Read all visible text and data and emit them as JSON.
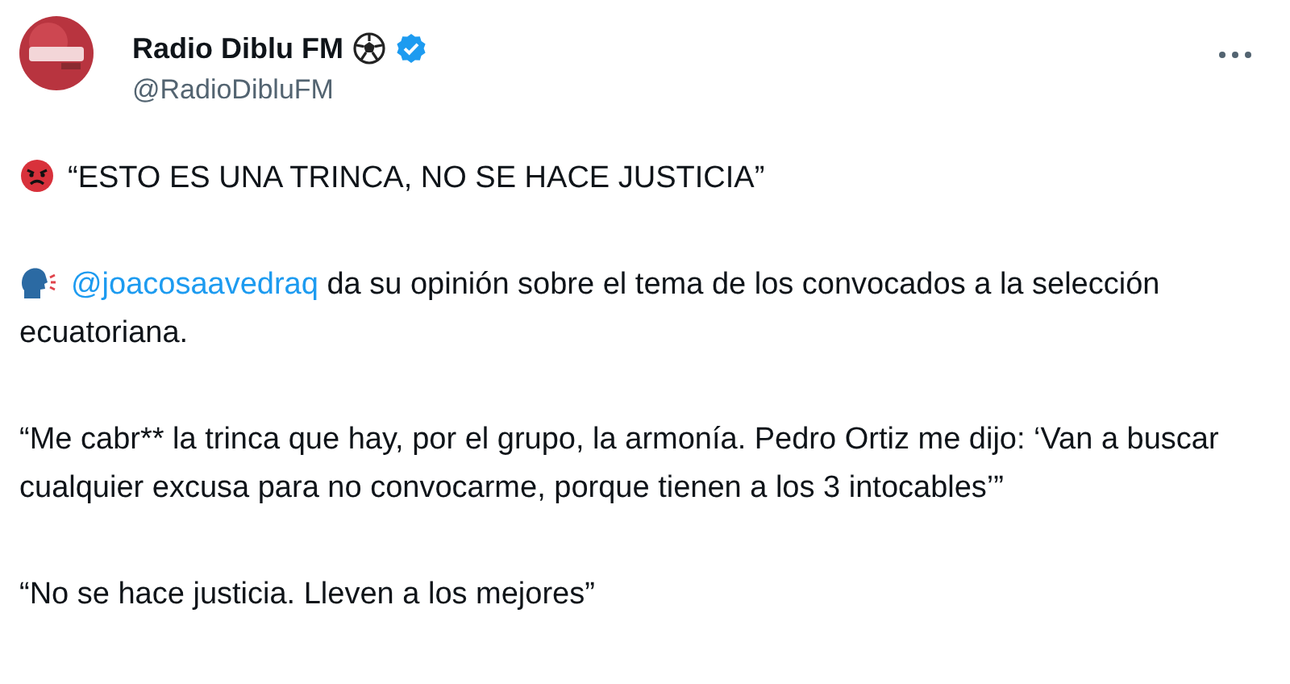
{
  "author": {
    "name": "Radio Diblu FM",
    "handle": "@RadioDibluFM",
    "verified": true
  },
  "paragraphs": [
    {
      "kind": "angry",
      "text": "“ESTO ES UNA TRINCA, NO SE HACE JUSTICIA”"
    },
    {
      "kind": "speaking",
      "mention": "@joacosaavedraq",
      "text": " da su opinión sobre el tema de los convocados a la selección ecuatoriana."
    },
    {
      "kind": "plain",
      "text": "“Me cabr** la trinca que hay, por el grupo, la armonía. Pedro Ortiz me dijo: ‘Van a buscar cualquier excusa para no convocarme, porque tienen a los 3 intocables’”"
    },
    {
      "kind": "plain",
      "text": "“No se hace justicia. Lleven a los mejores”"
    }
  ]
}
